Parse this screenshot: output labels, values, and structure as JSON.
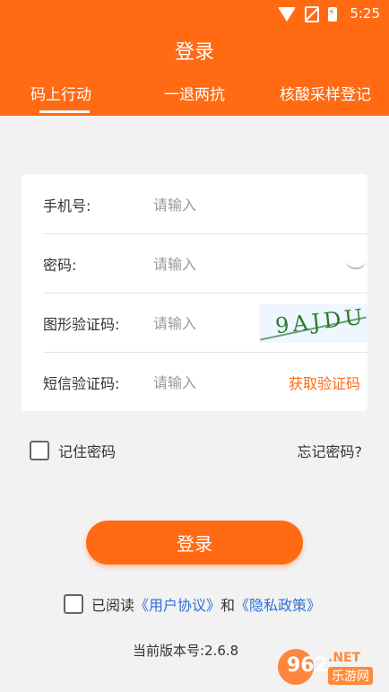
{
  "status": {
    "time": "5:25",
    "icons": [
      "wifi-icon",
      "no-sim-icon",
      "battery-charging-icon"
    ]
  },
  "header": {
    "title": "登录",
    "tabs": [
      "码上行动",
      "一退两抗",
      "核酸采样登记"
    ]
  },
  "form": {
    "phone": {
      "label": "手机号:",
      "placeholder": "请输入"
    },
    "password": {
      "label": "密码:",
      "placeholder": "请输入"
    },
    "captcha": {
      "label": "图形验证码:",
      "placeholder": "请输入",
      "captcha_text": "9AJDU"
    },
    "sms": {
      "label": "短信验证码:",
      "placeholder": "请输入",
      "get_code": "获取验证码"
    }
  },
  "options": {
    "remember": "记住密码",
    "forgot": "忘记密码?"
  },
  "login_button": "登录",
  "agreement": {
    "prefix": "已阅读",
    "user_agreement": "《用户协议》",
    "and": "和",
    "privacy_policy": "《隐私政策》"
  },
  "version": "当前版本号:2.6.8",
  "watermark": {
    "number": "962",
    "net": ".NET",
    "sub": "乐游网"
  },
  "colors": {
    "accent": "#ff6a13",
    "link": "#2f6fd6",
    "background": "#f2f2f2"
  }
}
